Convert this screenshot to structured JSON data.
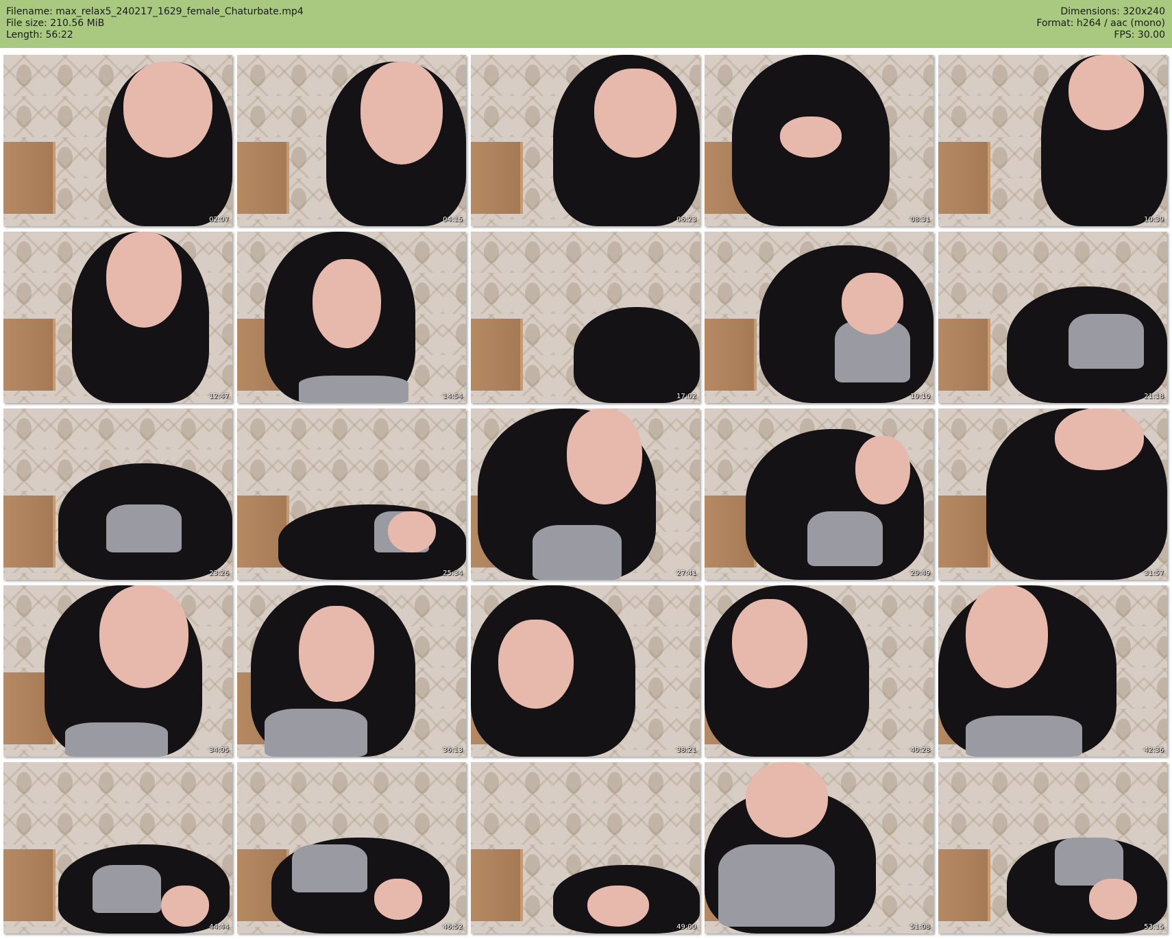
{
  "header": {
    "filename": "Filename: max_relax5_240217_1629_female_Chaturbate.mp4",
    "filesize": "File size: 210.56 MiB",
    "length": "Length: 56:22",
    "dimensions": "Dimensions: 320x240",
    "format": "Format: h264 / aac (mono)",
    "fps": "FPS: 30.00"
  },
  "thumbnails": [
    {
      "timestamp": "02:07"
    },
    {
      "timestamp": "04:15"
    },
    {
      "timestamp": "06:23"
    },
    {
      "timestamp": "08:31"
    },
    {
      "timestamp": "10:39"
    },
    {
      "timestamp": "12:47"
    },
    {
      "timestamp": "14:54"
    },
    {
      "timestamp": "17:02"
    },
    {
      "timestamp": "19:10"
    },
    {
      "timestamp": "21:18"
    },
    {
      "timestamp": "23:26"
    },
    {
      "timestamp": "25:34"
    },
    {
      "timestamp": "27:41"
    },
    {
      "timestamp": "29:49"
    },
    {
      "timestamp": "31:57"
    },
    {
      "timestamp": "34:05"
    },
    {
      "timestamp": "36:13"
    },
    {
      "timestamp": "38:21"
    },
    {
      "timestamp": "40:28"
    },
    {
      "timestamp": "42:36"
    },
    {
      "timestamp": "44:44"
    },
    {
      "timestamp": "46:52"
    },
    {
      "timestamp": "49:00"
    },
    {
      "timestamp": "51:08"
    },
    {
      "timestamp": "53:15"
    }
  ]
}
